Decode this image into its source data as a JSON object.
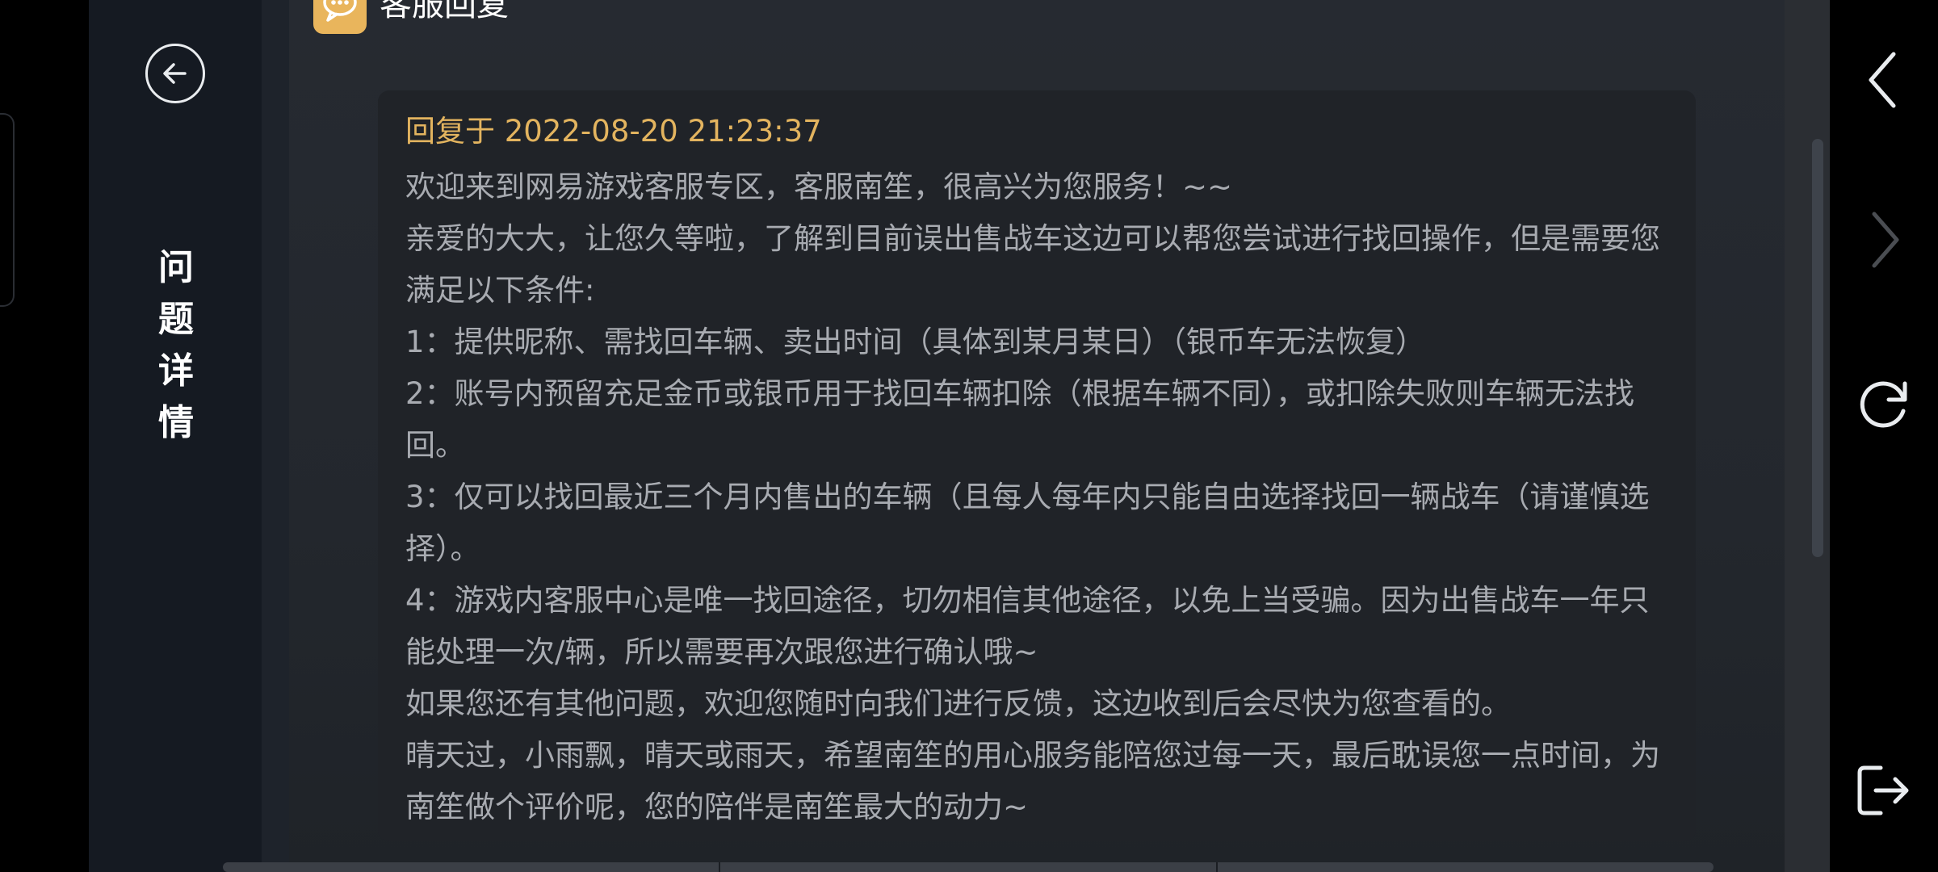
{
  "sidebar": {
    "title": "问题详情"
  },
  "section": {
    "title": "客服回复"
  },
  "reply": {
    "time": "回复于 2022-08-20 21:23:37",
    "lines": [
      "欢迎来到网易游戏客服专区，客服南笙，很高兴为您服务！~~",
      "亲爱的大大，让您久等啦，了解到目前误出售战车这边可以帮您尝试进行找回操作，但是需要您满足以下条件:",
      "1：提供昵称、需找回车辆、卖出时间（具体到某月某日）（银币车无法恢复）",
      "2：账号内预留充足金币或银币用于找回车辆扣除（根据车辆不同），或扣除失败则车辆无法找回。",
      "3：仅可以找回最近三个月内售出的车辆（且每人每年内只能自由选择找回一辆战车（请谨慎选择）。",
      "4：游戏内客服中心是唯一找回途径，切勿相信其他途径，以免上当受骗。因为出售战车一年只能处理一次/辆，所以需要再次跟您进行确认哦~",
      "如果您还有其他问题，欢迎您随时向我们进行反馈，这边收到后会尽快为您查看的。",
      "晴天过，小雨飘，晴天或雨天，希望南笙的用心服务能陪您过每一天，最后耽误您一点时间，为南笙做个评价呢，您的陪伴是南笙最大的动力~"
    ]
  },
  "icons": {
    "back": "arrow-left-circle-icon",
    "chat": "chat-bubble-icon",
    "nav_back": "chevron-left-icon",
    "nav_forward": "chevron-right-icon",
    "refresh": "refresh-icon",
    "exit": "exit-icon"
  },
  "colors": {
    "accent": "#e3b45f",
    "text": "#a8abb1",
    "panel": "#202328"
  }
}
